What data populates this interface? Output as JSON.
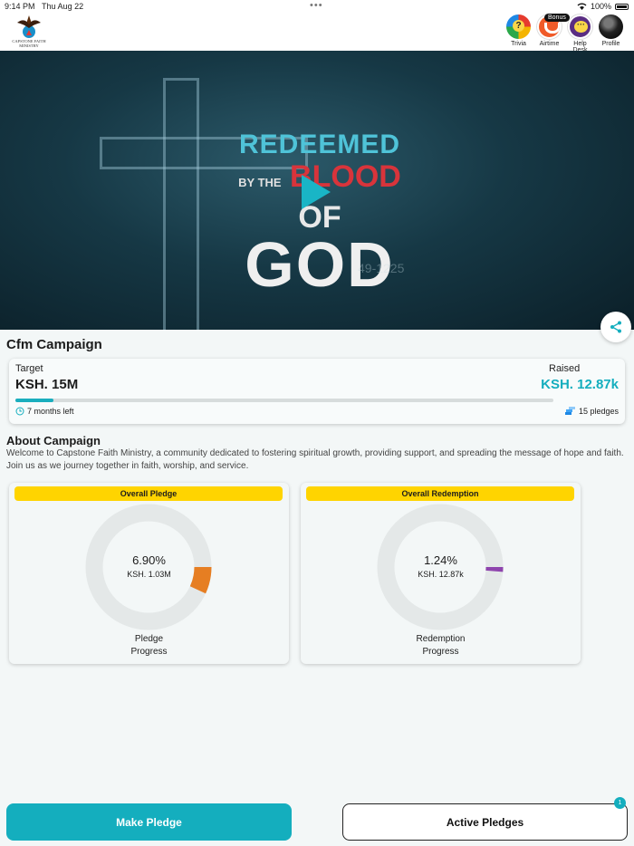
{
  "status_bar": {
    "time": "9:14 PM",
    "date": "Thu Aug 22",
    "battery": "100%"
  },
  "header": {
    "logo_text": "CAPSTONE FAITH MINISTRY",
    "nav": [
      {
        "label": "Trivia",
        "icon": "trivia-icon"
      },
      {
        "label": "Airtime",
        "icon": "airtime-icon",
        "badge": "Bonus"
      },
      {
        "label": "Help Desk",
        "icon": "help-desk-icon"
      },
      {
        "label": "Profile",
        "icon": "profile-avatar"
      }
    ]
  },
  "hero": {
    "line1": "REDEEMED",
    "line2_by": "BY THE",
    "line2_blood": "BLOOD",
    "line2_of": "OF",
    "line3": "GOD",
    "verse": "49-1225"
  },
  "campaign": {
    "title": "Cfm Campaign",
    "target_label": "Target",
    "target_value": "KSH. 15M",
    "raised_label": "Raised",
    "raised_value": "KSH. 12.87k",
    "progress_fraction": 0.07,
    "time_left": "7 months left",
    "pledges": "15 pledges"
  },
  "about": {
    "heading": "About Campaign",
    "text": "Welcome to Capstone Faith Ministry, a community dedicated to fostering spiritual growth, providing support, and spreading the message of hope and faith. Join us as we journey together in faith, worship, and service."
  },
  "stats": [
    {
      "badge": "Overall Pledge",
      "percent": "6.90%",
      "amount": "KSH. 1.03M",
      "caption_line1": "Pledge",
      "caption_line2": "Progress",
      "fraction": 0.069,
      "color": "#e67e22"
    },
    {
      "badge": "Overall Redemption",
      "percent": "1.24%",
      "amount": "KSH. 12.87k",
      "caption_line1": "Redemption",
      "caption_line2": "Progress",
      "fraction": 0.0124,
      "color": "#8e44ad"
    }
  ],
  "actions": {
    "make_pledge": "Make Pledge",
    "active_pledges": "Active Pledges",
    "active_count": "1"
  },
  "colors": {
    "accent": "#14aebe",
    "badge": "#ffd400"
  }
}
